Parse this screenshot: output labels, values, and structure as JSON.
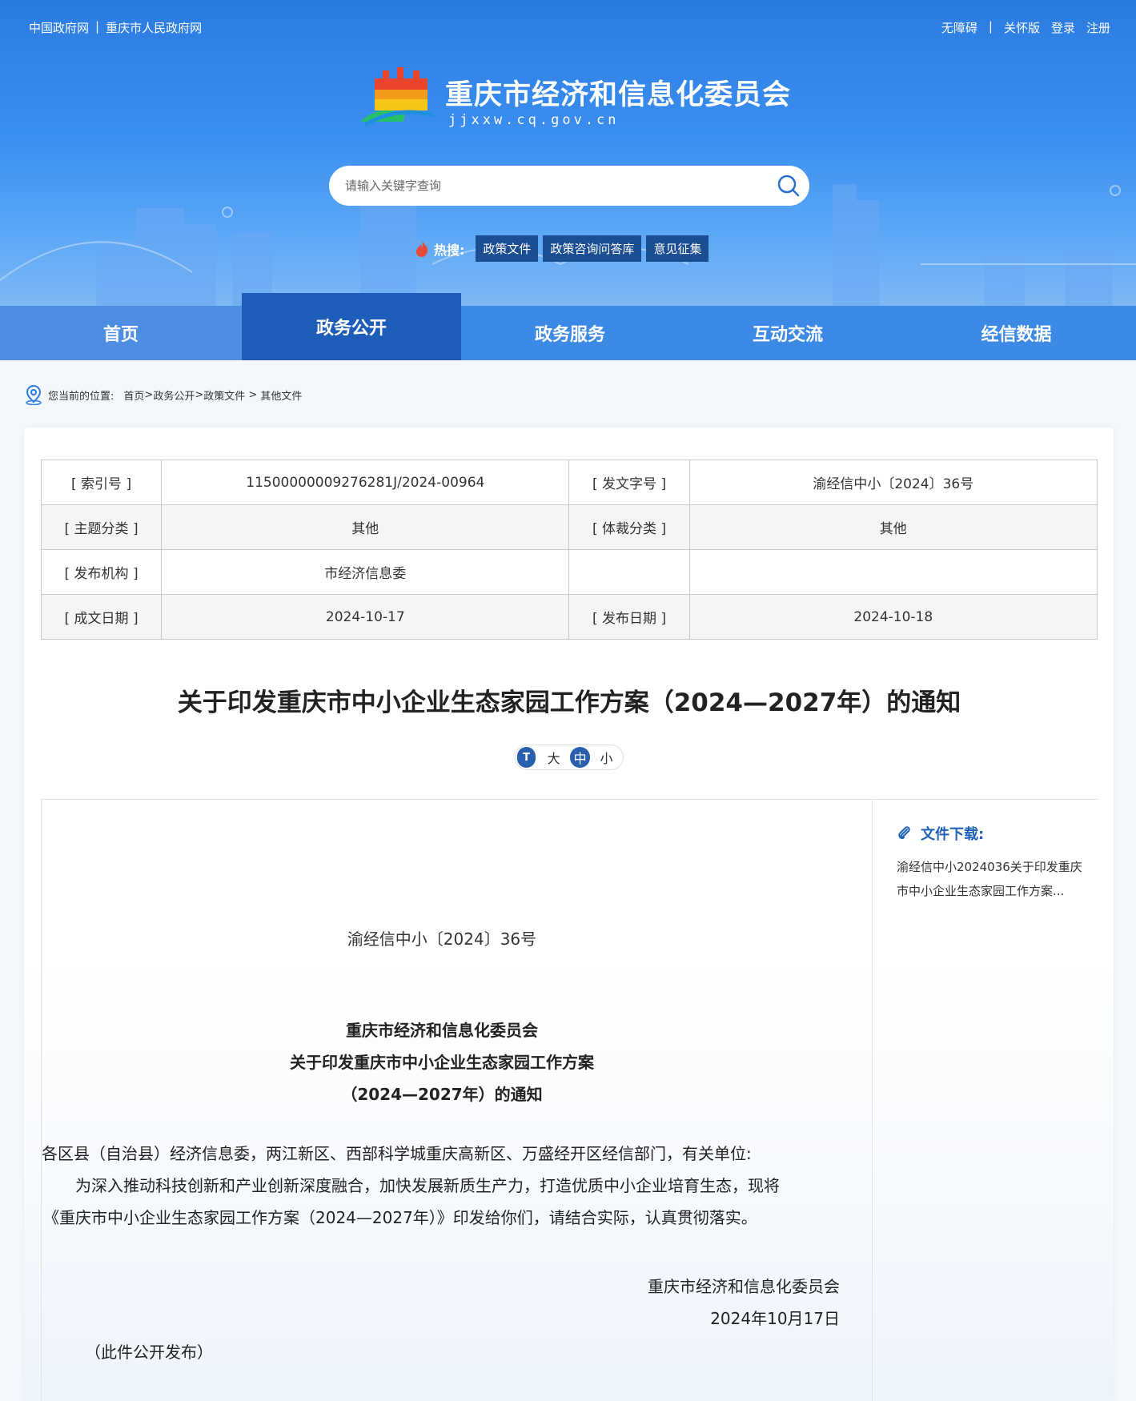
{
  "top_links": {
    "left": [
      "中国政府网",
      "重庆市人民政府网"
    ],
    "separator": "|",
    "right": [
      "无障碍",
      "|",
      "关怀版",
      "登录",
      "注册"
    ]
  },
  "site": {
    "title": "重庆市经济和信息化委员会",
    "domain": "jjxxw.cq.gov.cn"
  },
  "search": {
    "placeholder": "请输入关键字查询"
  },
  "hot_search": {
    "label": "热搜:",
    "tags": [
      "政策文件",
      "政策咨询问答库",
      "意见征集"
    ]
  },
  "nav": {
    "items": [
      "首页",
      "政务公开",
      "政务服务",
      "互动交流",
      "经信数据"
    ],
    "active_index": 1
  },
  "breadcrumb": {
    "prefix": "您当前的位置:",
    "items": [
      "首页",
      ">",
      "政务公开",
      ">",
      "政策文件",
      " > ",
      "其他文件"
    ]
  },
  "meta_table": {
    "rows": [
      [
        "[ 索引号 ]",
        "11500000009276281J/2024-00964",
        "[ 发文字号 ]",
        "渝经信中小〔2024〕36号"
      ],
      [
        "[ 主题分类 ]",
        "其他",
        "[ 体裁分类 ]",
        "其他"
      ],
      [
        "[ 发布机构 ]",
        "市经济信息委",
        "",
        ""
      ],
      [
        "[ 成文日期 ]",
        "2024-10-17",
        "[ 发布日期 ]",
        "2024-10-18"
      ]
    ]
  },
  "article": {
    "title": "关于印发重庆市中小企业生态家园工作方案（2024—2027年）的通知",
    "font_size": {
      "icon": "T",
      "options": [
        "大",
        "中",
        "小"
      ],
      "selected": "中"
    },
    "doc_number": "渝经信中小〔2024〕36号",
    "heading_lines": [
      "重庆市经济和信息化委员会",
      "关于印发重庆市中小企业生态家园工作方案",
      "（2024—2027年）的通知"
    ],
    "salutation": "各区县（自治县）经济信息委，两江新区、西部科学城重庆高新区、万盛经开区经信部门，有关单位:",
    "body_line1": "为深入推动科技创新和产业创新深度融合，加快发展新质生产力，打造优质中小企业培育生态，现将",
    "body_line2": "《重庆市中小企业生态家园工作方案（2024—2027年）》印发给你们，请结合实际，认真贯彻落实。",
    "signer": "重庆市经济和信息化委员会",
    "date": "2024年10月17日",
    "note": "（此件公开发布）"
  },
  "sidebar": {
    "download_title": "文件下载:",
    "file_line1": "渝经信中小2024036关于印发重庆",
    "file_line2": "市中小企业生态家园工作方案..."
  },
  "colors": {
    "header_blue": "#2a7be0",
    "nav_active": "#1d5cb8",
    "hot_tag": "#1b4e92",
    "accent": "#2062b6"
  }
}
